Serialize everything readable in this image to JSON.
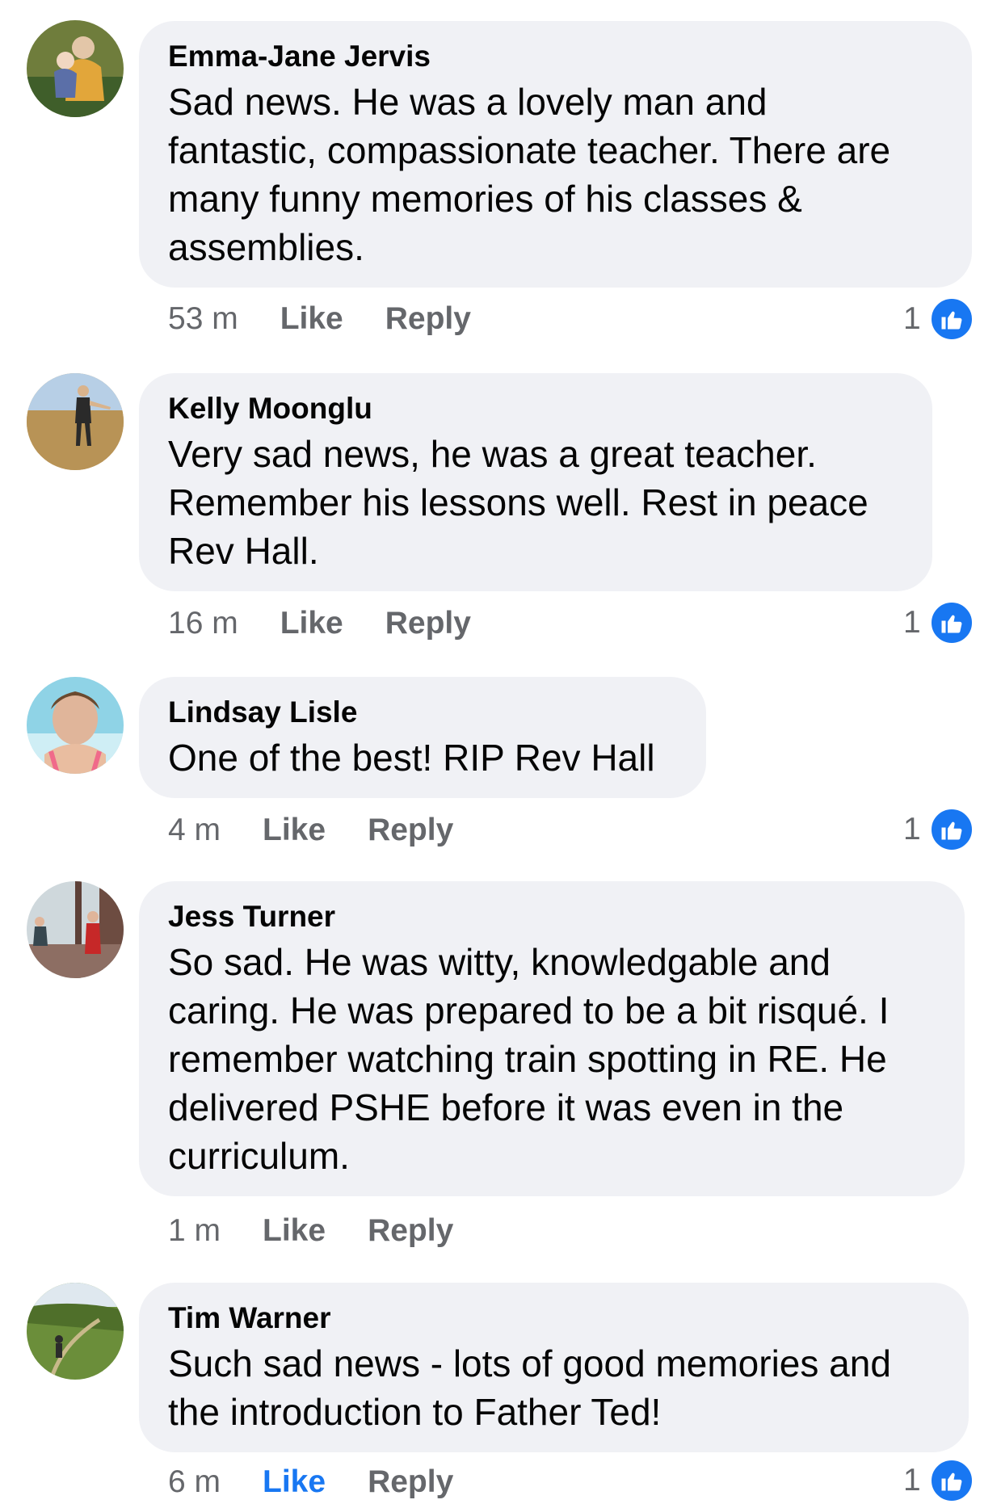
{
  "comments": [
    {
      "author": "Emma-Jane Jervis",
      "lines": [
        "Sad news. He was a lovely man and",
        "fantastic, compassionate teacher. There are",
        "many funny memories of his classes &",
        "assemblies."
      ],
      "time": "53 m",
      "like_label": "Like",
      "reply_label": "Reply",
      "reaction_count": "1",
      "liked": false,
      "avatar_colors": [
        "#5b6a34",
        "#e2a63a",
        "#3f5e2a"
      ]
    },
    {
      "author": "Kelly Moonglu",
      "lines": [
        "Very sad news, he was a great teacher.",
        "Remember his lessons well. Rest in peace",
        "Rev Hall."
      ],
      "time": "16 m",
      "like_label": "Like",
      "reply_label": "Reply",
      "reaction_count": "1",
      "liked": false,
      "avatar_colors": [
        "#c9a66b",
        "#b7cfe6",
        "#2a2a2a"
      ]
    },
    {
      "author": "Lindsay Lisle",
      "lines": [
        "One of the best! RIP Rev Hall"
      ],
      "time": "4 m",
      "like_label": "Like",
      "reply_label": "Reply",
      "reaction_count": "1",
      "liked": false,
      "avatar_colors": [
        "#8fd3e6",
        "#e0b59a",
        "#f06a8a"
      ]
    },
    {
      "author": "Jess Turner",
      "lines": [
        "So sad. He was witty, knowledgable  and",
        "caring. He was prepared to be a bit risqué. I",
        "remember watching train spotting in RE. He",
        "delivered PSHE before it was even in the",
        "curriculum."
      ],
      "time": "1 m",
      "like_label": "Like",
      "reply_label": "Reply",
      "reaction_count": "",
      "liked": false,
      "avatar_colors": [
        "#cfd8dc",
        "#6d4c41",
        "#c62828"
      ]
    },
    {
      "author": "Tim Warner",
      "lines": [
        "Such sad news - lots of good memories and",
        "the introduction to Father Ted!"
      ],
      "time": "6 m",
      "like_label": "Like",
      "reply_label": "Reply",
      "reaction_count": "1",
      "liked": true,
      "avatar_colors": [
        "#6b8e3a",
        "#dfe8ef",
        "#3d5a1f"
      ]
    }
  ],
  "colors": {
    "bubble": "#f0f1f5",
    "secondary_text": "#65676b",
    "like_blue": "#1877f2"
  },
  "icons": {
    "reaction": "thumbs-up-icon"
  }
}
